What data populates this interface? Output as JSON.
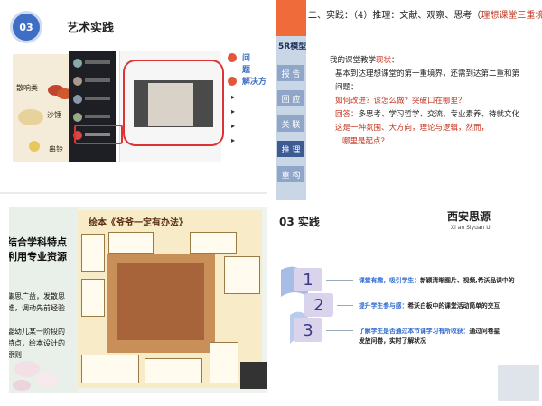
{
  "panel1": {
    "badge": "03",
    "title": "艺术实践",
    "instruments": [
      "散响类",
      "沙锤",
      "串铃"
    ],
    "right_items": [
      "问题",
      "解决方"
    ]
  },
  "panel2": {
    "heading_black": "二、实践：（4）推理：文献、观察、思考（",
    "heading_red": "理想课堂三重境",
    "sidebar_title": "5R模型",
    "sidebar_items": [
      "报 告",
      "回 应",
      "关 联",
      "推 理",
      "重 构"
    ],
    "lines": [
      {
        "text": "我的课堂教学",
        "red": "现状",
        "suffix": "："
      },
      {
        "text": "基本到达理想课堂的第一重境界，还需到达第二重和第"
      },
      {
        "text": "问题："
      },
      {
        "red": "如何改进？该怎么做？突破口在哪里？"
      },
      {
        "text": "回答：",
        "rest": "多思考、学习哲学、交流、专业素养、待就文化"
      },
      {
        "red": "这是一种氛围、大方向，理论与逻辑，然而，"
      },
      {
        "red": "哪里是起点？"
      }
    ]
  },
  "panel3": {
    "heading_lines": [
      "结合学科特点",
      "利用专业资源"
    ],
    "text_lines": [
      "集思广益，发散思",
      "维，调动先前经验",
      "",
      "婴幼儿某一阶段的",
      "特点，绘本设计的",
      "原则"
    ],
    "book_title": "绘本《爷爷一定有办法》"
  },
  "panel4": {
    "title": "03  实践",
    "logo": "西安思源",
    "logo_sub": "Xi an Siyuan U",
    "items": [
      {
        "num": "1",
        "blue": "课堂有趣，吸引学生：",
        "black": "新颖清晰图片、视频,希沃品课中的"
      },
      {
        "num": "2",
        "blue": "提升学生参与感：",
        "black": "希沃白板中的课堂活动简单的交互"
      },
      {
        "num": "3",
        "blue": "了解学生是否通过本节课学习有所收获：",
        "black": "通过问卷星",
        "black2": "发放问卷，实时了解状况"
      }
    ]
  }
}
